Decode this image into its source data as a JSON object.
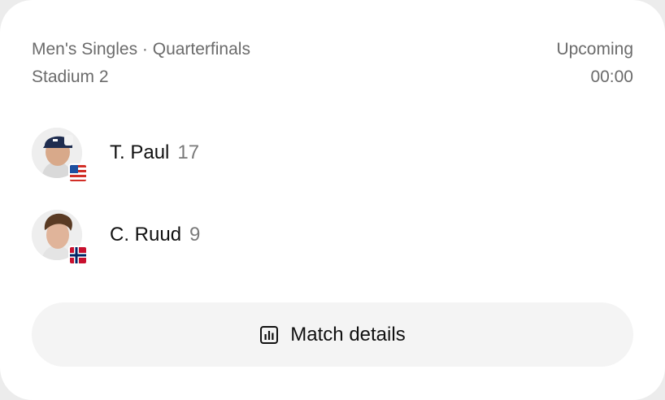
{
  "match": {
    "event": "Men's Singles · Quarterfinals",
    "court": "Stadium 2",
    "status": "Upcoming",
    "time": "00:00"
  },
  "players": [
    {
      "name": "T. Paul",
      "seed": "17",
      "flag_icon": "us-flag-icon",
      "avatar_icon": "player-photo"
    },
    {
      "name": "C. Ruud",
      "seed": "9",
      "flag_icon": "norway-flag-icon",
      "avatar_icon": "player-photo"
    }
  ],
  "actions": {
    "details_label": "Match details",
    "details_icon": "chart-icon"
  },
  "colors": {
    "muted_text": "#6b6b6b",
    "button_bg": "#f4f4f4"
  }
}
